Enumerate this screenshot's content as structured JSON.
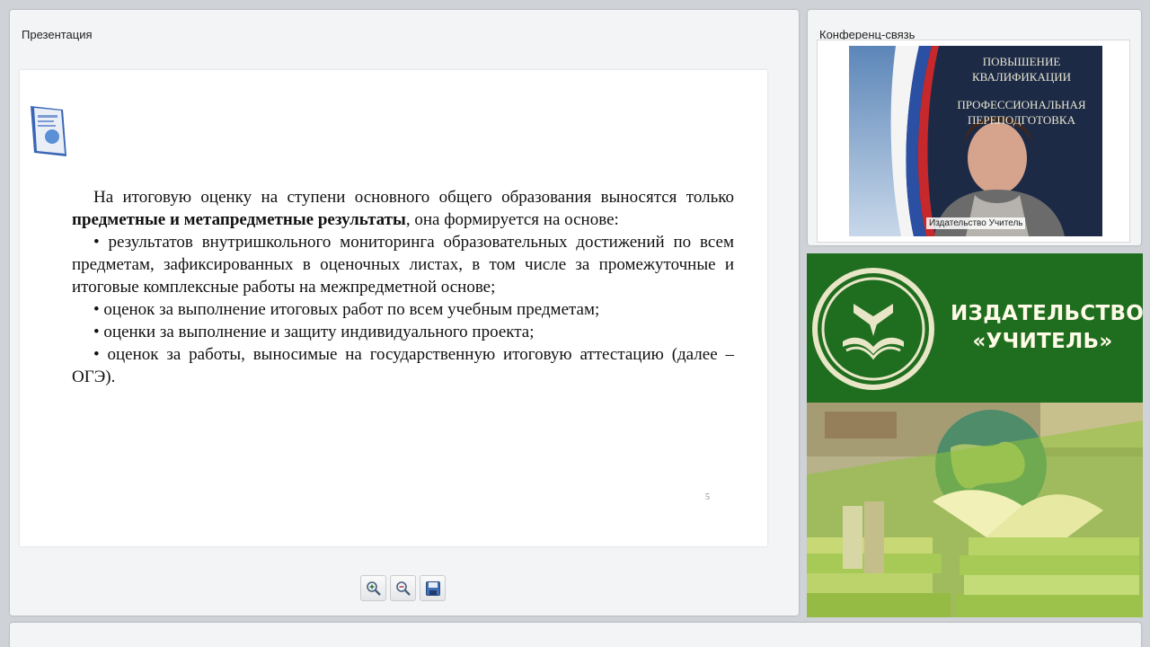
{
  "presentation": {
    "title": "Презентация",
    "slide": {
      "paragraphs": [
        {
          "indent": true,
          "segments": [
            {
              "text": "На итоговую оценку на ступени основного общего образования выносятся только ",
              "bold": false
            },
            {
              "text": "предметные и метапредметные результаты",
              "bold": true
            },
            {
              "text": ", она формируется на основе:",
              "bold": false
            }
          ]
        },
        {
          "indent": true,
          "segments": [
            {
              "text": "• результатов внутришкольного мониторинга образовательных достижений по всем предметам, зафиксированных в оценочных листах, в том числе за промежуточные и итоговые комплексные работы на межпредметной основе;",
              "bold": false
            }
          ]
        },
        {
          "indent": true,
          "segments": [
            {
              "text": "• оценок за выполнение итоговых работ по всем учебным предметам;",
              "bold": false
            }
          ]
        },
        {
          "indent": true,
          "segments": [
            {
              "text": "• оценки за выполнение и защиту индивидуального проекта;",
              "bold": false
            }
          ]
        },
        {
          "indent": true,
          "segments": [
            {
              "text": "• оценок за работы, выносимые на государственную итоговую аттестацию (далее – ОГЭ).",
              "bold": false
            }
          ]
        }
      ],
      "page_number": "5"
    },
    "toolbar": {
      "zoom_in_icon": "zoom-in-icon",
      "zoom_out_icon": "zoom-out-icon",
      "save_icon": "save-icon"
    }
  },
  "conference": {
    "title": "Конференц-связь",
    "video_label": "Издательство Учитель",
    "backdrop_text": [
      "ПОВЫШЕНИЕ",
      "КВАЛИФИКАЦИИ",
      "ПРОФЕССИОНАЛЬНАЯ",
      "ПЕРЕПОДГОТОВКА"
    ]
  },
  "banner": {
    "publisher_line1": "ИЗДАТЕЛЬСТВО",
    "publisher_line2": "«УЧИТЕЛЬ»"
  },
  "colors": {
    "banner_green": "#1f6d1e",
    "banner_text": "#fffbe8",
    "panel_bg": "#f3f4f5"
  }
}
